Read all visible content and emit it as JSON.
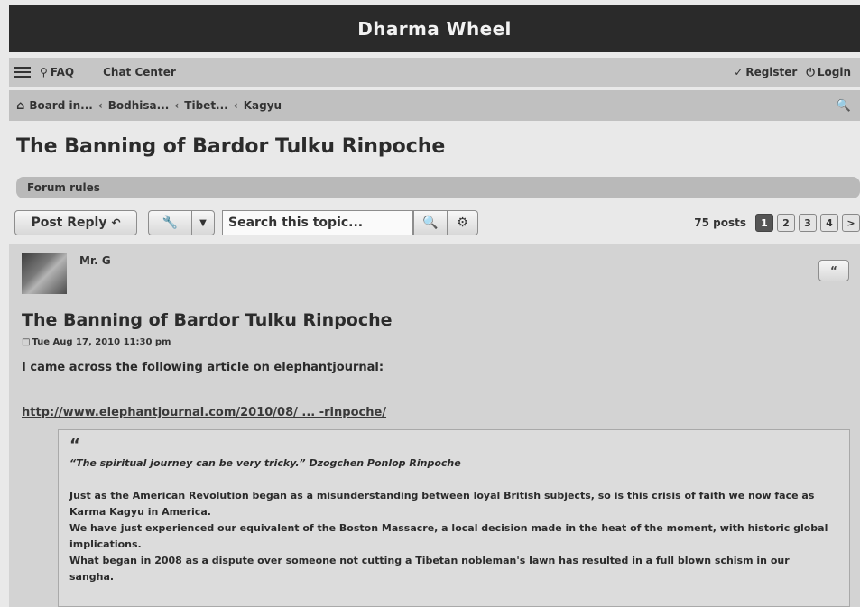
{
  "header": {
    "site_title": "Dharma Wheel"
  },
  "nav": {
    "faq_label": "FAQ",
    "chat_label": "Chat Center",
    "register_label": "Register",
    "login_label": "Login"
  },
  "breadcrumb": {
    "items": [
      "Board in...",
      "Bodhisa...",
      "Tibet...",
      "Kagyu"
    ],
    "separator": "‹"
  },
  "topic": {
    "title": "The Banning of Bardor Tulku Rinpoche"
  },
  "forum_rules": {
    "label": "Forum rules"
  },
  "actions": {
    "post_reply_label": "Post Reply",
    "search_placeholder": "Search this topic...",
    "post_count": "75 posts",
    "pages": [
      "1",
      "2",
      "3",
      "4",
      ">"
    ],
    "active_page": "1"
  },
  "post": {
    "author": "Mr. G",
    "quote_button_label": "“",
    "title": "The Banning of Bardor Tulku Rinpoche",
    "date": "Tue Aug 17, 2010 11:30 pm",
    "intro": "I came across the following article on elephantjournal:",
    "link": "http://www.elephantjournal.com/2010/08/ ... -rinpoche/",
    "quote": {
      "mark": "“",
      "line1": "“The spiritual journey can be very tricky.” Dzogchen Ponlop Rinpoche",
      "paragraphs": [
        "Just as the American Revolution began as a misunderstanding between loyal British subjects, so is this crisis of faith we now face as Karma Kagyu in America.",
        "We have just experienced our equivalent of the Boston Massacre, a local decision made in the heat of the moment, with historic global implications.",
        "What began in 2008 as a dispute over someone not cutting a Tibetan nobleman's lawn has resulted in a full blown schism in our sangha."
      ]
    }
  },
  "icons": {
    "menu": "hamburger-menu-icon",
    "faq": "question-icon",
    "register": "pencil-icon",
    "login": "power-icon",
    "home": "home-icon",
    "search": "search-icon",
    "wrench": "wrench-icon",
    "gear": "gear-icon",
    "reply": "reply-arrow-icon",
    "doc": "document-icon"
  }
}
